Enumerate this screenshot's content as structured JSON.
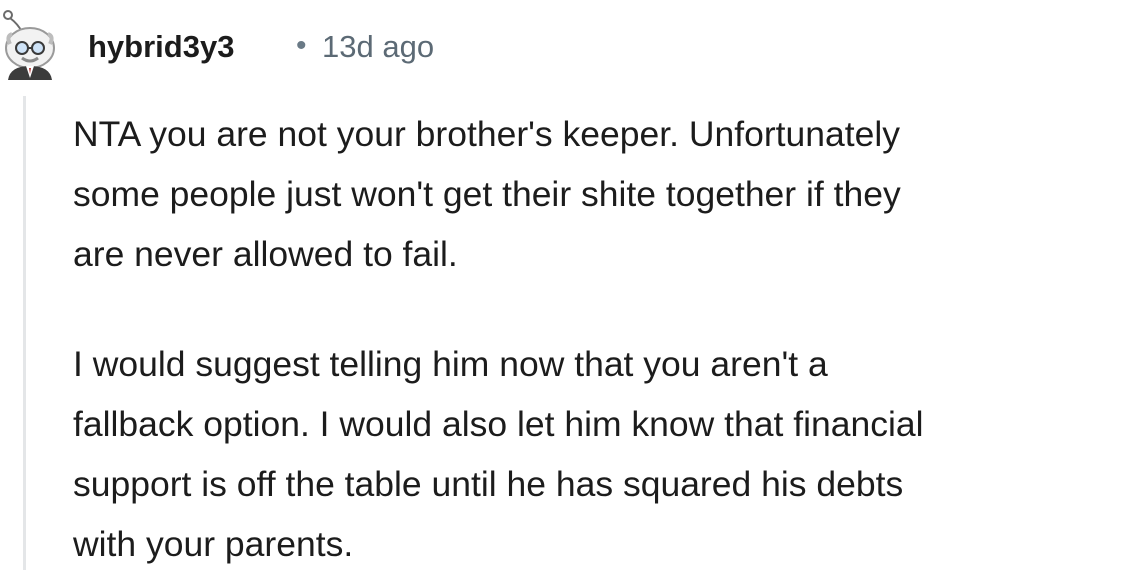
{
  "comment": {
    "author": "hybrid3y3",
    "separator": "•",
    "timestamp": "13d ago",
    "avatar_icon": "snoo-avatar-icon",
    "paragraphs": [
      {
        "lines": [
          "NTA you are not your brother's keeper. Unfortunately",
          "some people just won't get their shite together if they",
          "are never allowed to fail."
        ]
      },
      {
        "lines": [
          "I would suggest telling him now that you aren't a",
          "fallback option. I would also let him know that financial",
          "support is off the table until he has squared his debts",
          "with your parents."
        ]
      }
    ]
  }
}
